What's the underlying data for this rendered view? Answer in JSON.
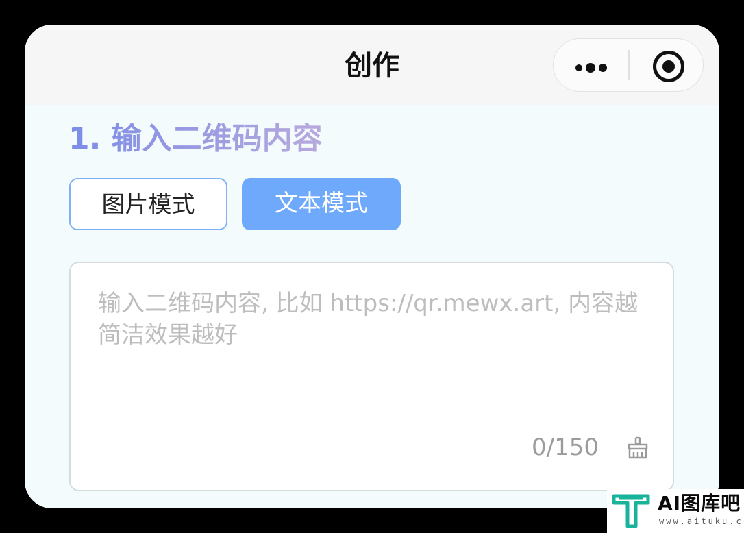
{
  "navbar": {
    "title": "创作",
    "more_icon": "more-dots-icon",
    "close_icon": "target-circle-icon"
  },
  "section": {
    "title": "1. 输入二维码内容"
  },
  "modes": {
    "image_mode_label": "图片模式",
    "text_mode_label": "文本模式",
    "selected": "文本模式"
  },
  "input": {
    "value": "",
    "placeholder": "输入二维码内容, 比如 https://qr.mewx.art, 内容越简洁效果越好",
    "char_count": "0/150",
    "clear_icon": "broom-icon"
  },
  "watermark": {
    "brand": "AI图库吧",
    "domain": "www.aituku.cc"
  },
  "colors": {
    "accent_blue": "#6fa9fb",
    "title_gradient_start": "#7c8ce6",
    "title_gradient_end": "#b8a9dd",
    "watermark_teal": "#19b39b"
  }
}
